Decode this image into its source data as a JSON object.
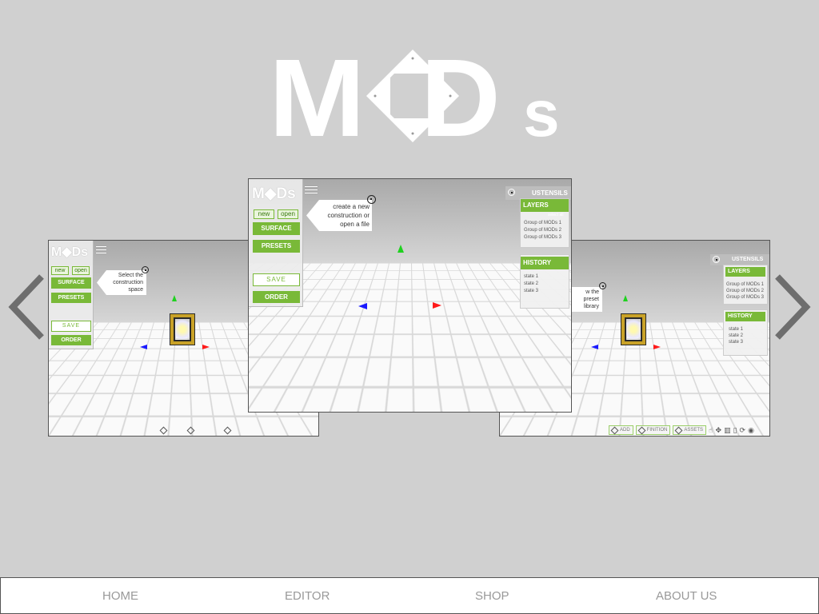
{
  "brand": {
    "logo_text_m": "M",
    "logo_text_d": "D",
    "logo_text_s": "s",
    "logo_color": "#ffffff"
  },
  "colors": {
    "background": "#d0d0d0",
    "accent_green": "#79b938",
    "arrow_gray": "#6e6e6e"
  },
  "carousel": {
    "prev_icon": "chevron-left-icon",
    "next_icon": "chevron-right-icon",
    "slides": [
      {
        "id": "left",
        "callout": "Select the construction space"
      },
      {
        "id": "center",
        "callout": "create a new construction or open a file"
      },
      {
        "id": "right",
        "callout": "w the preset library"
      }
    ]
  },
  "editor": {
    "logo_text": "M◆Ds",
    "new_label": "new",
    "open_label": "open",
    "surface_label": "SURFACE",
    "presets_label": "PRESETS",
    "save_label": "SAVE",
    "order_label": "ORDER",
    "ustensils_label": "USTENSILS",
    "layers_label": "LAYERS",
    "select_all_label": "select all",
    "layers": [
      "Group of MODs 1",
      "Group of MODs 2",
      "Group of MODs 3"
    ],
    "history_label": "HISTORY",
    "history": [
      "state 1",
      "state 2",
      "state 3"
    ],
    "toolbar": {
      "add_label": "ADD",
      "finition_label": "FINITION",
      "assets_label": "ASSETS"
    }
  },
  "nav": {
    "items": [
      {
        "label": "HOME"
      },
      {
        "label": "EDITOR"
      },
      {
        "label": "SHOP"
      },
      {
        "label": "ABOUT US"
      }
    ]
  }
}
